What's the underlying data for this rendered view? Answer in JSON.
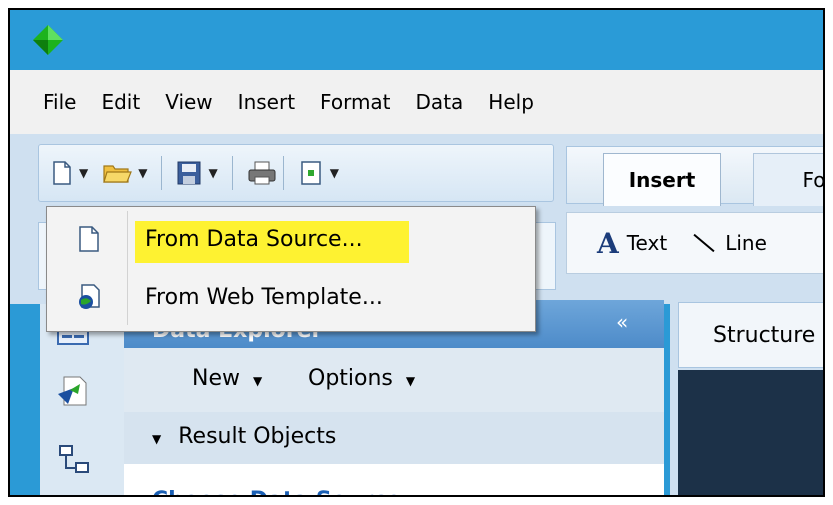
{
  "menu": {
    "items": [
      "File",
      "Edit",
      "View",
      "Insert",
      "Format",
      "Data",
      "Help"
    ]
  },
  "toolbar": {
    "icons": [
      "new-document-icon",
      "open-folder-icon",
      "save-icon",
      "print-icon",
      "page-setup-icon"
    ]
  },
  "ribbon": {
    "tabs": [
      "Insert",
      "Fo"
    ],
    "text_tool_label": "Text",
    "line_tool_label": "Line"
  },
  "dropdown": {
    "items": [
      {
        "label": "From Data Source...",
        "icon": "new-document-icon"
      },
      {
        "label": "From Web Template...",
        "icon": "web-globe-document-icon"
      }
    ],
    "highlight_color": "#fff21c"
  },
  "explorer": {
    "title": "Data Explorer",
    "collapse_glyph": "«",
    "new_label": "New",
    "options_label": "Options",
    "section_label": "Result Objects",
    "choose_link": "Choose Data Source"
  },
  "structure": {
    "tab_label": "Structure"
  },
  "colors": {
    "titlebar": "#2a9bd7",
    "accent_blue": "#4d8bc9",
    "logo_green": "#1db31d"
  }
}
